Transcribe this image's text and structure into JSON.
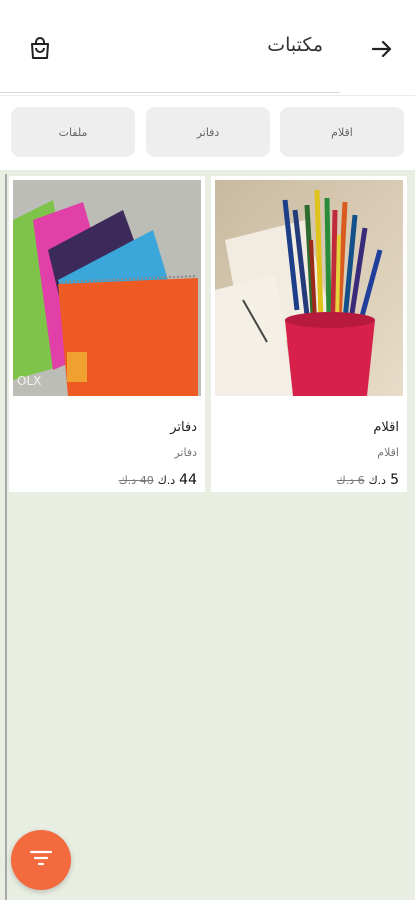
{
  "header": {
    "title": "مكتبات",
    "icons": {
      "cart": "shopping-bag-icon",
      "back": "arrow-right-icon"
    }
  },
  "categories": [
    {
      "label": "اقلام"
    },
    {
      "label": "دفاتر"
    },
    {
      "label": "ملفات"
    }
  ],
  "products": [
    {
      "name": "اقلام",
      "subtitle": "اقلام",
      "price": "5",
      "currency": "د.ك",
      "old_price": "6 د.ك",
      "image": "colored-pencils-in-cup"
    },
    {
      "name": "دفاتر",
      "subtitle": "دفاتر",
      "price": "44",
      "currency": "د.ك",
      "old_price": "40 د.ك",
      "image": "stack-of-spiral-notebooks"
    }
  ],
  "fab": {
    "icon": "filter-icon"
  },
  "colors": {
    "accent": "#f26a3d",
    "content_bg": "#e9eee3",
    "chip_bg": "#eeeeee"
  }
}
